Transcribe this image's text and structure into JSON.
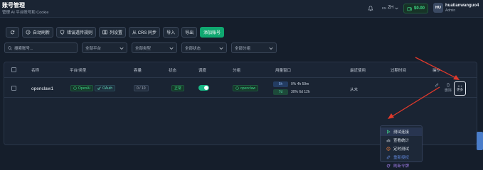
{
  "header": {
    "title": "账号管理",
    "subtitle": "管理 AI 平台账号和 Cookie",
    "lang_code": "EN",
    "lang_current": "ZH",
    "balance": "$0.00",
    "user_initials": "HU",
    "user_name": "huatianwanguo4",
    "user_role": "Admin"
  },
  "toolbar": {
    "refresh_icon": "refresh-icon",
    "auto_refresh": "自动刷新",
    "error_rules": "错误透传规则",
    "column_settings": "列设置",
    "crs_sync": "从 CRS 同步",
    "import": "导入",
    "export": "导出",
    "add_account": "添加账号"
  },
  "filters": {
    "search_placeholder": "搜索账号...",
    "platform": "全部平台",
    "type": "全部类型",
    "status": "全部状态",
    "group": "全部分组"
  },
  "table": {
    "headers": {
      "name": "名称",
      "platform": "平台/类型",
      "capacity": "容量",
      "status": "状态",
      "schedule": "调度",
      "group": "分组",
      "usage": "用量窗口",
      "last_used": "最近使用",
      "expires": "过期时间",
      "actions": "操作"
    },
    "rows": [
      {
        "name": "openclaw1",
        "platform": "OpenAI",
        "type": "OAuth",
        "capacity": "0 / 10",
        "status": "正常",
        "schedule_on": true,
        "group": "openclaw",
        "usage_5h_label": "5h",
        "usage_5h": "0% 4h 59m",
        "usage_7d_label": "7d",
        "usage_7d": "30% 6d 12h",
        "last_used": "从未",
        "edit": "编辑",
        "delete": "删除",
        "more": "更多"
      }
    ]
  },
  "menu": {
    "items": [
      {
        "label": "测试连接",
        "icon": "play-icon"
      },
      {
        "label": "查看统计",
        "icon": "chart-icon"
      },
      {
        "label": "定时测试",
        "icon": "clock-icon"
      },
      {
        "label": "重新授权",
        "icon": "link-icon"
      },
      {
        "label": "刷新令牌",
        "icon": "refresh-icon"
      }
    ]
  },
  "colors": {
    "background": "#151e2b",
    "accent_green": "#0fa870",
    "annotation_red": "#e0392b"
  }
}
